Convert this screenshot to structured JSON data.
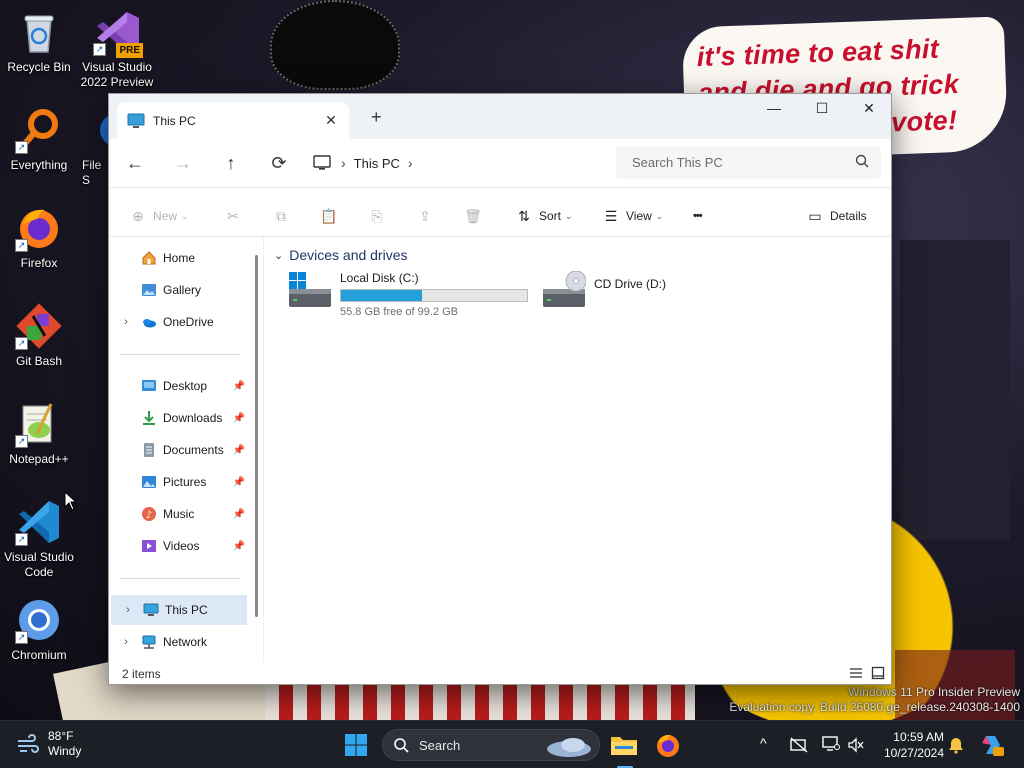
{
  "desktop": {
    "icons": [
      {
        "label": "Recycle Bin",
        "icon": "recycle-bin-icon"
      },
      {
        "label": "Visual Studio 2022 Preview",
        "icon": "visual-studio-icon",
        "badge": "PRE"
      },
      {
        "label": "Everything",
        "icon": "everything-icon"
      },
      {
        "label": "File S",
        "icon": "file-icon"
      },
      {
        "label": "Firefox",
        "icon": "firefox-icon"
      },
      {
        "label": "Git Bash",
        "icon": "git-bash-icon"
      },
      {
        "label": "Notepad++",
        "icon": "notepad-plus-plus-icon"
      },
      {
        "label": "Visual Studio Code",
        "icon": "vscode-icon"
      },
      {
        "label": "Chromium",
        "icon": "chromium-icon"
      }
    ],
    "wallpaper_text": [
      "it's time to eat shit",
      "and die and go trick",
      "vote!"
    ],
    "watermark": [
      "Windows 11 Pro Insider Preview",
      "Evaluation copy. Build 26080.ge_release.240308-1400"
    ]
  },
  "window": {
    "tab_title": "This PC",
    "new_tab": "+",
    "controls": {
      "minimize": "—",
      "maximize": "☐",
      "close": "✕"
    },
    "nav": {
      "back": "←",
      "forward": "→",
      "up": "↑",
      "refresh": "⟳"
    },
    "breadcrumb": "This PC",
    "search_placeholder": "Search This PC",
    "toolbar": {
      "new_label": "New",
      "sort_label": "Sort",
      "view_label": "View",
      "more_label": "•••",
      "details_label": "Details"
    },
    "navpane": {
      "top": [
        {
          "label": "Home",
          "icon": "home-icon"
        },
        {
          "label": "Gallery",
          "icon": "gallery-icon"
        },
        {
          "label": "OneDrive",
          "icon": "onedrive-icon",
          "expandable": true
        }
      ],
      "quick": [
        {
          "label": "Desktop",
          "icon": "desktop-folder-icon"
        },
        {
          "label": "Downloads",
          "icon": "downloads-folder-icon"
        },
        {
          "label": "Documents",
          "icon": "documents-folder-icon"
        },
        {
          "label": "Pictures",
          "icon": "pictures-folder-icon"
        },
        {
          "label": "Music",
          "icon": "music-folder-icon"
        },
        {
          "label": "Videos",
          "icon": "videos-folder-icon"
        }
      ],
      "bottom": [
        {
          "label": "This PC",
          "icon": "this-pc-icon",
          "selected": true
        },
        {
          "label": "Network",
          "icon": "network-icon"
        }
      ]
    },
    "group_header": "Devices and drives",
    "drives": [
      {
        "name": "Local Disk (C:)",
        "free_text": "55.8 GB free of 99.2 GB",
        "used_fraction": 0.4375,
        "icon": "hard-drive-icon"
      },
      {
        "name": "CD Drive (D:)",
        "icon": "cd-drive-icon"
      }
    ],
    "status_count": "2 items",
    "accent": "#26a0da"
  },
  "taskbar": {
    "weather_temp": "88°F",
    "weather_desc": "Windy",
    "search_label": "Search",
    "time": "10:59 AM",
    "date": "10/27/2024",
    "tray_chevron": "^"
  }
}
